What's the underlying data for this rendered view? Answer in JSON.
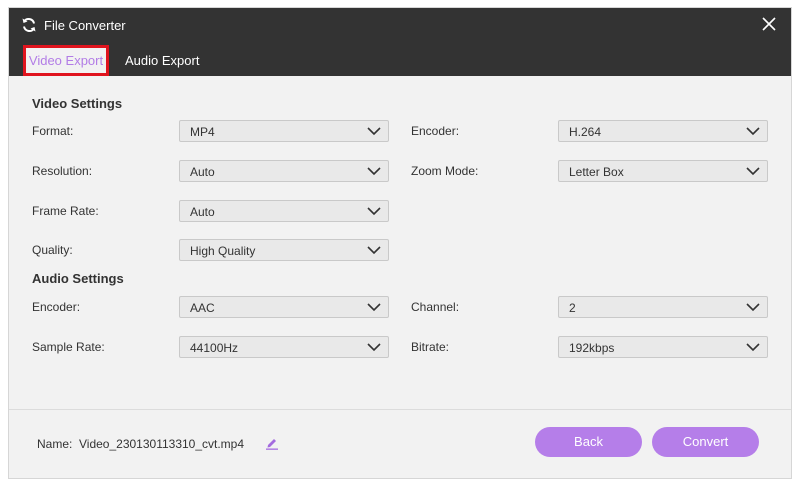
{
  "window": {
    "title": "File Converter"
  },
  "tabs": {
    "video": "Video Export",
    "audio": "Audio Export"
  },
  "video_settings": {
    "title": "Video Settings",
    "format": {
      "label": "Format:",
      "value": "MP4"
    },
    "encoder": {
      "label": "Encoder:",
      "value": "H.264"
    },
    "resolution": {
      "label": "Resolution:",
      "value": "Auto"
    },
    "zoom_mode": {
      "label": "Zoom Mode:",
      "value": "Letter Box"
    },
    "frame_rate": {
      "label": "Frame Rate:",
      "value": "Auto"
    },
    "quality": {
      "label": "Quality:",
      "value": "High Quality"
    }
  },
  "audio_settings": {
    "title": "Audio Settings",
    "encoder": {
      "label": "Encoder:",
      "value": "AAC"
    },
    "channel": {
      "label": "Channel:",
      "value": "2"
    },
    "sample_rate": {
      "label": "Sample Rate:",
      "value": "44100Hz"
    },
    "bitrate": {
      "label": "Bitrate:",
      "value": "192kbps"
    }
  },
  "footer": {
    "name_label": "Name:",
    "name_value": "Video_230130113310_cvt.mp4",
    "back_label": "Back",
    "convert_label": "Convert"
  },
  "colors": {
    "accent": "#b57ee9",
    "titlebar": "#333333",
    "tab_highlight": "#e0141e"
  }
}
